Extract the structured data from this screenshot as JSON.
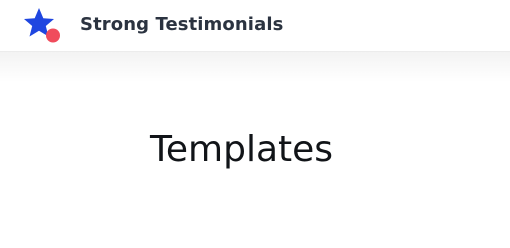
{
  "header": {
    "brand_name": "Strong Testimonials",
    "logo_icon": "star-logo-icon",
    "colors": {
      "star": "#1f46e0",
      "dot": "#f04c5c",
      "brand_text": "#2b3340"
    }
  },
  "main": {
    "page_title": "Templates"
  }
}
